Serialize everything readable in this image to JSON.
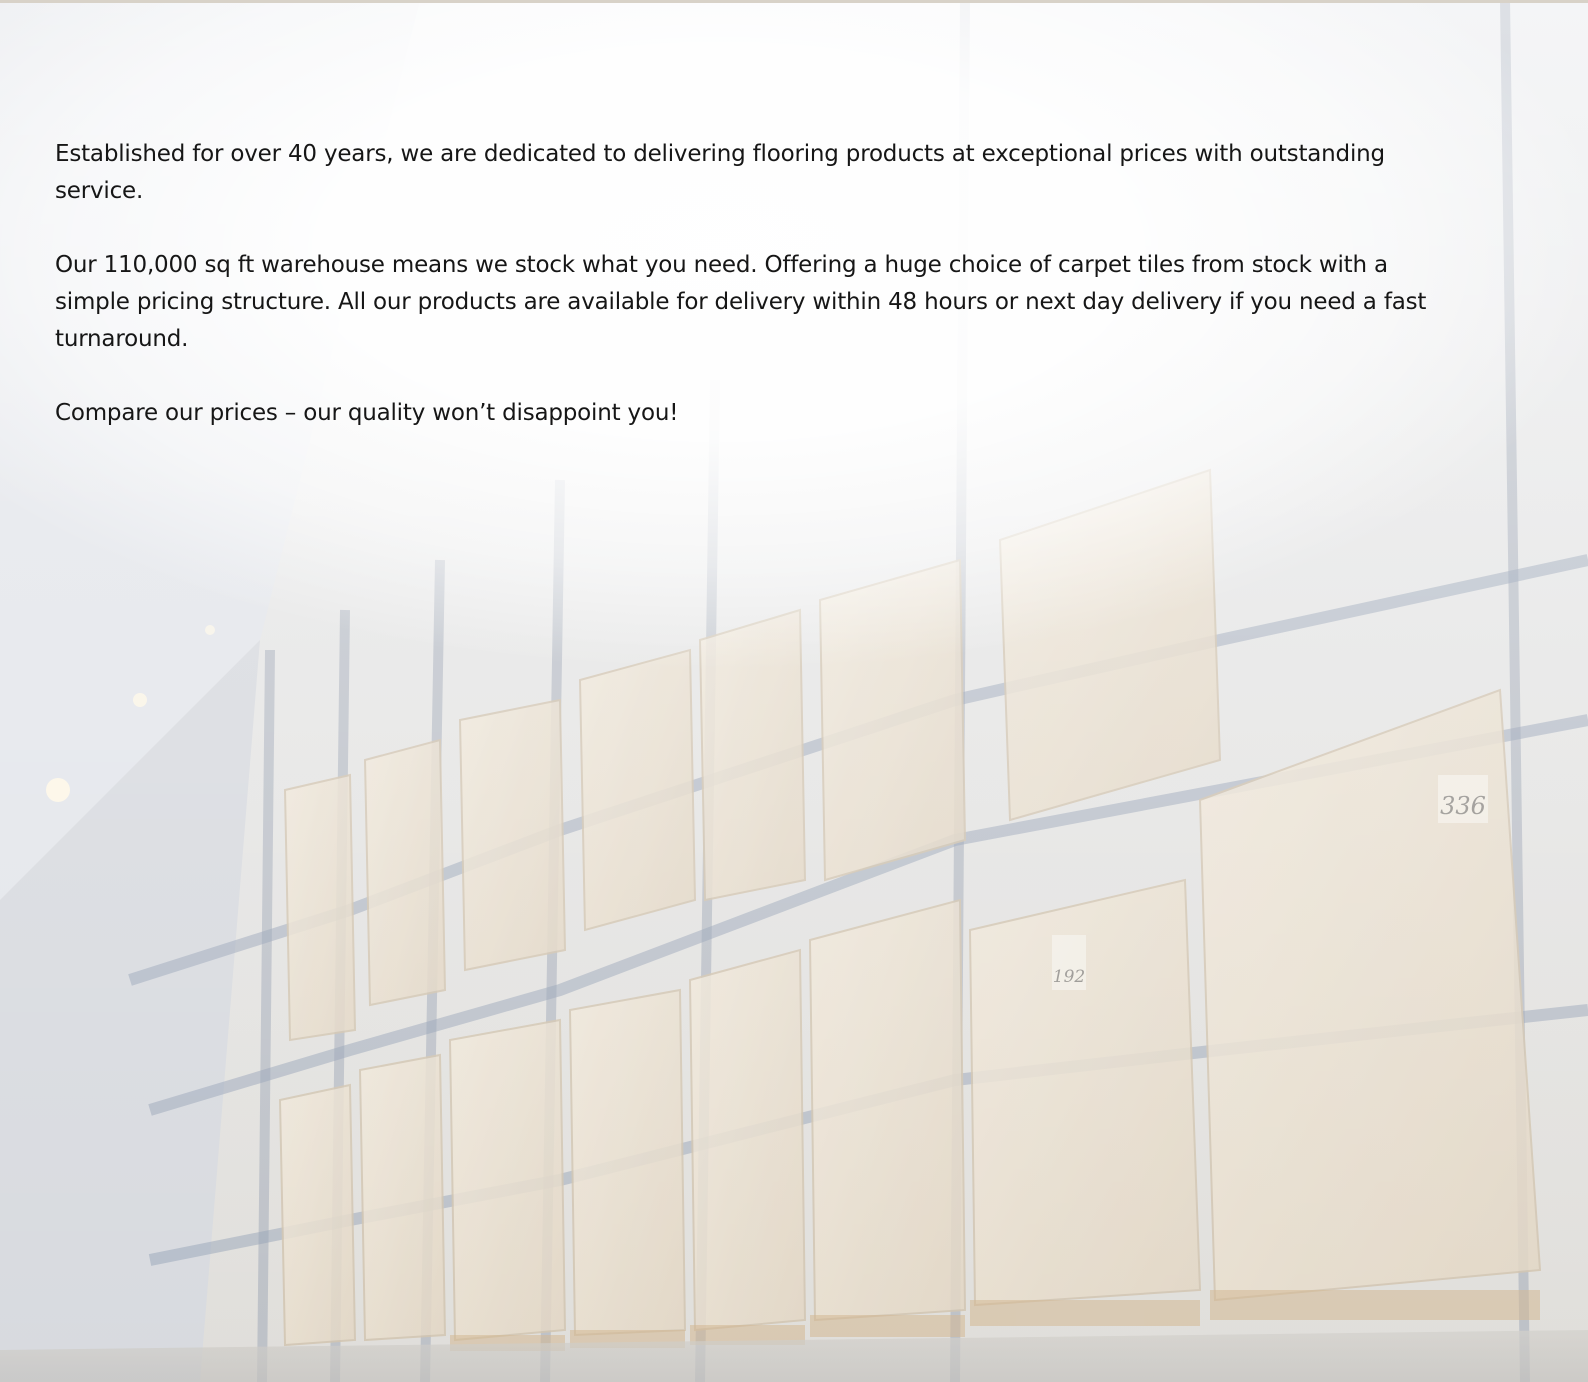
{
  "intro": {
    "paragraphs": [
      "Established for over 40 years, we are dedicated to delivering flooring products at exceptional prices with outstanding service.",
      "Our 110,000 sq ft warehouse means we stock what you need.  Offering a huge choice of carpet tiles from stock with a simple pricing structure.  All our products are available for delivery within 48 hours or next day delivery if you need a fast turnaround.",
      "Compare our prices – our quality won’t disappoint you!"
    ]
  },
  "background": {
    "image": "warehouse-racking-photo",
    "rack_labels": [
      "336",
      "192"
    ]
  }
}
